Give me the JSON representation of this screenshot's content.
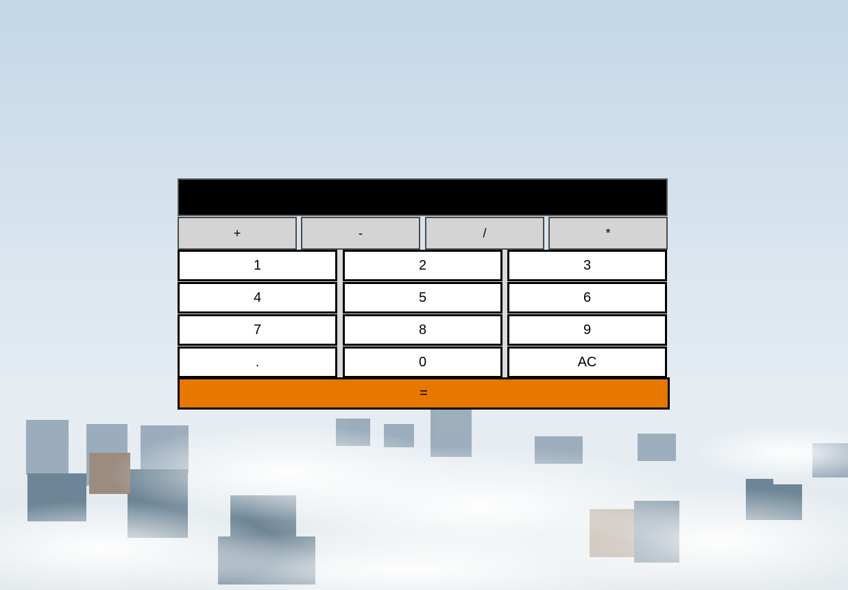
{
  "calculator": {
    "display_value": "",
    "operators": [
      "+",
      "-",
      "/",
      "*"
    ],
    "keys": [
      [
        "1",
        "2",
        "3"
      ],
      [
        "4",
        "5",
        "6"
      ],
      [
        "7",
        "8",
        "9"
      ],
      [
        ".",
        "0",
        "AC"
      ]
    ],
    "equals_label": "=",
    "colors": {
      "display": "#000000",
      "operator_bg": "#d4d4d4",
      "key_bg": "#ffffff",
      "equals_bg": "#e67800"
    }
  }
}
